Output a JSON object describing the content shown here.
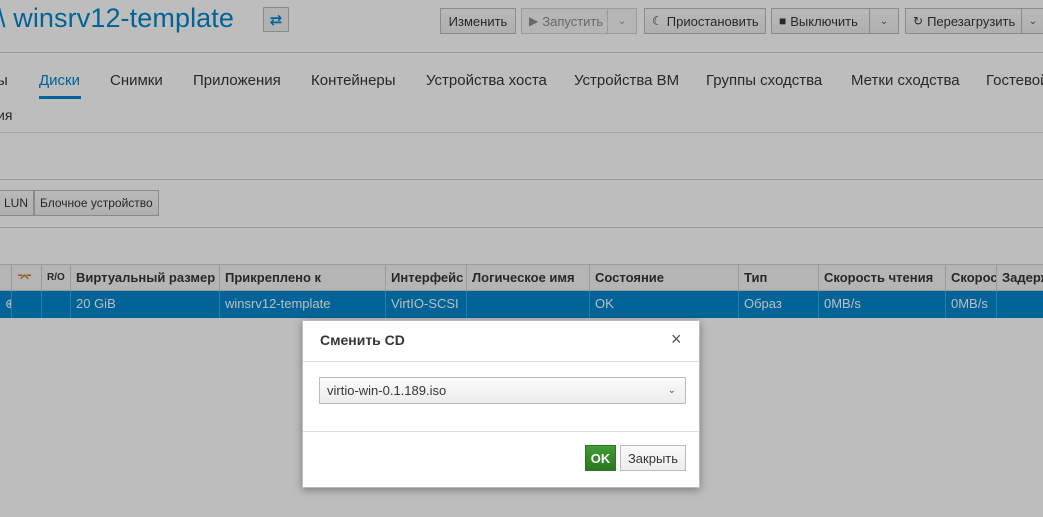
{
  "header": {
    "prefix": "\\",
    "title": "winsrv12-template",
    "swap_icon": "⇄"
  },
  "toolbar": {
    "edit": "Изменить",
    "run": "Запустить",
    "suspend": "Приостановить",
    "shutdown": "Выключить",
    "reboot": "Перезагрузить"
  },
  "tabs": [
    "ы",
    "Диски",
    "Снимки",
    "Приложения",
    "Контейнеры",
    "Устройства хоста",
    "Устройства ВМ",
    "Группы сходства",
    "Метки сходства",
    "Гостевой"
  ],
  "tabs_row2": "ия",
  "disk_actions": {
    "lun": "LUN",
    "block": "Блочное устройство"
  },
  "grid": {
    "columns": [
      "",
      "",
      "R/O",
      "Виртуальный размер",
      "Прикреплено к",
      "Интерфейс",
      "Логическое имя",
      "Состояние",
      "Тип",
      "Скорость чтения",
      "Скорость",
      "Задерж"
    ],
    "rows": [
      [
        "",
        "",
        "",
        "20 GiB",
        "winsrv12-template",
        "VirtIO-SCSI",
        "",
        "OK",
        "Образ",
        "0MB/s",
        "0MB/s",
        ""
      ]
    ]
  },
  "dialog": {
    "title": "Сменить CD",
    "close_glyph": "×",
    "selected_iso": "virtio-win-0.1.189.iso",
    "ok": "OK",
    "close": "Закрыть"
  },
  "colors": {
    "accent": "#0088ce",
    "ok_button": "#2d7623"
  }
}
